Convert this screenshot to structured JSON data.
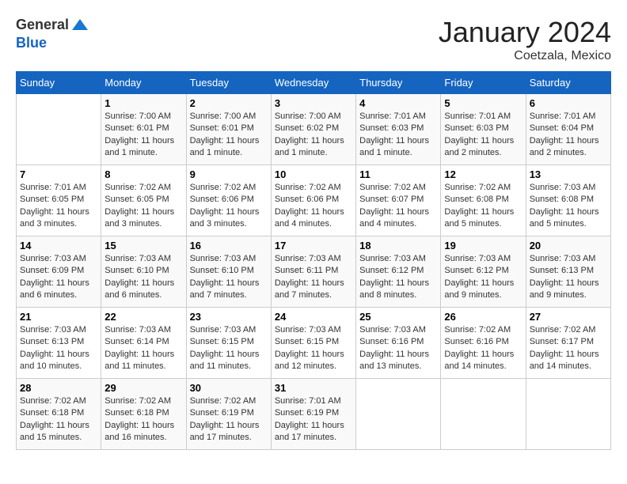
{
  "logo": {
    "general": "General",
    "blue": "Blue"
  },
  "title": "January 2024",
  "subtitle": "Coetzala, Mexico",
  "days_header": [
    "Sunday",
    "Monday",
    "Tuesday",
    "Wednesday",
    "Thursday",
    "Friday",
    "Saturday"
  ],
  "weeks": [
    [
      {
        "day": "",
        "info": ""
      },
      {
        "day": "1",
        "info": "Sunrise: 7:00 AM\nSunset: 6:01 PM\nDaylight: 11 hours\nand 1 minute."
      },
      {
        "day": "2",
        "info": "Sunrise: 7:00 AM\nSunset: 6:01 PM\nDaylight: 11 hours\nand 1 minute."
      },
      {
        "day": "3",
        "info": "Sunrise: 7:00 AM\nSunset: 6:02 PM\nDaylight: 11 hours\nand 1 minute."
      },
      {
        "day": "4",
        "info": "Sunrise: 7:01 AM\nSunset: 6:03 PM\nDaylight: 11 hours\nand 1 minute."
      },
      {
        "day": "5",
        "info": "Sunrise: 7:01 AM\nSunset: 6:03 PM\nDaylight: 11 hours\nand 2 minutes."
      },
      {
        "day": "6",
        "info": "Sunrise: 7:01 AM\nSunset: 6:04 PM\nDaylight: 11 hours\nand 2 minutes."
      }
    ],
    [
      {
        "day": "7",
        "info": "Sunrise: 7:01 AM\nSunset: 6:05 PM\nDaylight: 11 hours\nand 3 minutes."
      },
      {
        "day": "8",
        "info": "Sunrise: 7:02 AM\nSunset: 6:05 PM\nDaylight: 11 hours\nand 3 minutes."
      },
      {
        "day": "9",
        "info": "Sunrise: 7:02 AM\nSunset: 6:06 PM\nDaylight: 11 hours\nand 3 minutes."
      },
      {
        "day": "10",
        "info": "Sunrise: 7:02 AM\nSunset: 6:06 PM\nDaylight: 11 hours\nand 4 minutes."
      },
      {
        "day": "11",
        "info": "Sunrise: 7:02 AM\nSunset: 6:07 PM\nDaylight: 11 hours\nand 4 minutes."
      },
      {
        "day": "12",
        "info": "Sunrise: 7:02 AM\nSunset: 6:08 PM\nDaylight: 11 hours\nand 5 minutes."
      },
      {
        "day": "13",
        "info": "Sunrise: 7:03 AM\nSunset: 6:08 PM\nDaylight: 11 hours\nand 5 minutes."
      }
    ],
    [
      {
        "day": "14",
        "info": "Sunrise: 7:03 AM\nSunset: 6:09 PM\nDaylight: 11 hours\nand 6 minutes."
      },
      {
        "day": "15",
        "info": "Sunrise: 7:03 AM\nSunset: 6:10 PM\nDaylight: 11 hours\nand 6 minutes."
      },
      {
        "day": "16",
        "info": "Sunrise: 7:03 AM\nSunset: 6:10 PM\nDaylight: 11 hours\nand 7 minutes."
      },
      {
        "day": "17",
        "info": "Sunrise: 7:03 AM\nSunset: 6:11 PM\nDaylight: 11 hours\nand 7 minutes."
      },
      {
        "day": "18",
        "info": "Sunrise: 7:03 AM\nSunset: 6:12 PM\nDaylight: 11 hours\nand 8 minutes."
      },
      {
        "day": "19",
        "info": "Sunrise: 7:03 AM\nSunset: 6:12 PM\nDaylight: 11 hours\nand 9 minutes."
      },
      {
        "day": "20",
        "info": "Sunrise: 7:03 AM\nSunset: 6:13 PM\nDaylight: 11 hours\nand 9 minutes."
      }
    ],
    [
      {
        "day": "21",
        "info": "Sunrise: 7:03 AM\nSunset: 6:13 PM\nDaylight: 11 hours\nand 10 minutes."
      },
      {
        "day": "22",
        "info": "Sunrise: 7:03 AM\nSunset: 6:14 PM\nDaylight: 11 hours\nand 11 minutes."
      },
      {
        "day": "23",
        "info": "Sunrise: 7:03 AM\nSunset: 6:15 PM\nDaylight: 11 hours\nand 11 minutes."
      },
      {
        "day": "24",
        "info": "Sunrise: 7:03 AM\nSunset: 6:15 PM\nDaylight: 11 hours\nand 12 minutes."
      },
      {
        "day": "25",
        "info": "Sunrise: 7:03 AM\nSunset: 6:16 PM\nDaylight: 11 hours\nand 13 minutes."
      },
      {
        "day": "26",
        "info": "Sunrise: 7:02 AM\nSunset: 6:16 PM\nDaylight: 11 hours\nand 14 minutes."
      },
      {
        "day": "27",
        "info": "Sunrise: 7:02 AM\nSunset: 6:17 PM\nDaylight: 11 hours\nand 14 minutes."
      }
    ],
    [
      {
        "day": "28",
        "info": "Sunrise: 7:02 AM\nSunset: 6:18 PM\nDaylight: 11 hours\nand 15 minutes."
      },
      {
        "day": "29",
        "info": "Sunrise: 7:02 AM\nSunset: 6:18 PM\nDaylight: 11 hours\nand 16 minutes."
      },
      {
        "day": "30",
        "info": "Sunrise: 7:02 AM\nSunset: 6:19 PM\nDaylight: 11 hours\nand 17 minutes."
      },
      {
        "day": "31",
        "info": "Sunrise: 7:01 AM\nSunset: 6:19 PM\nDaylight: 11 hours\nand 17 minutes."
      },
      {
        "day": "",
        "info": ""
      },
      {
        "day": "",
        "info": ""
      },
      {
        "day": "",
        "info": ""
      }
    ]
  ]
}
